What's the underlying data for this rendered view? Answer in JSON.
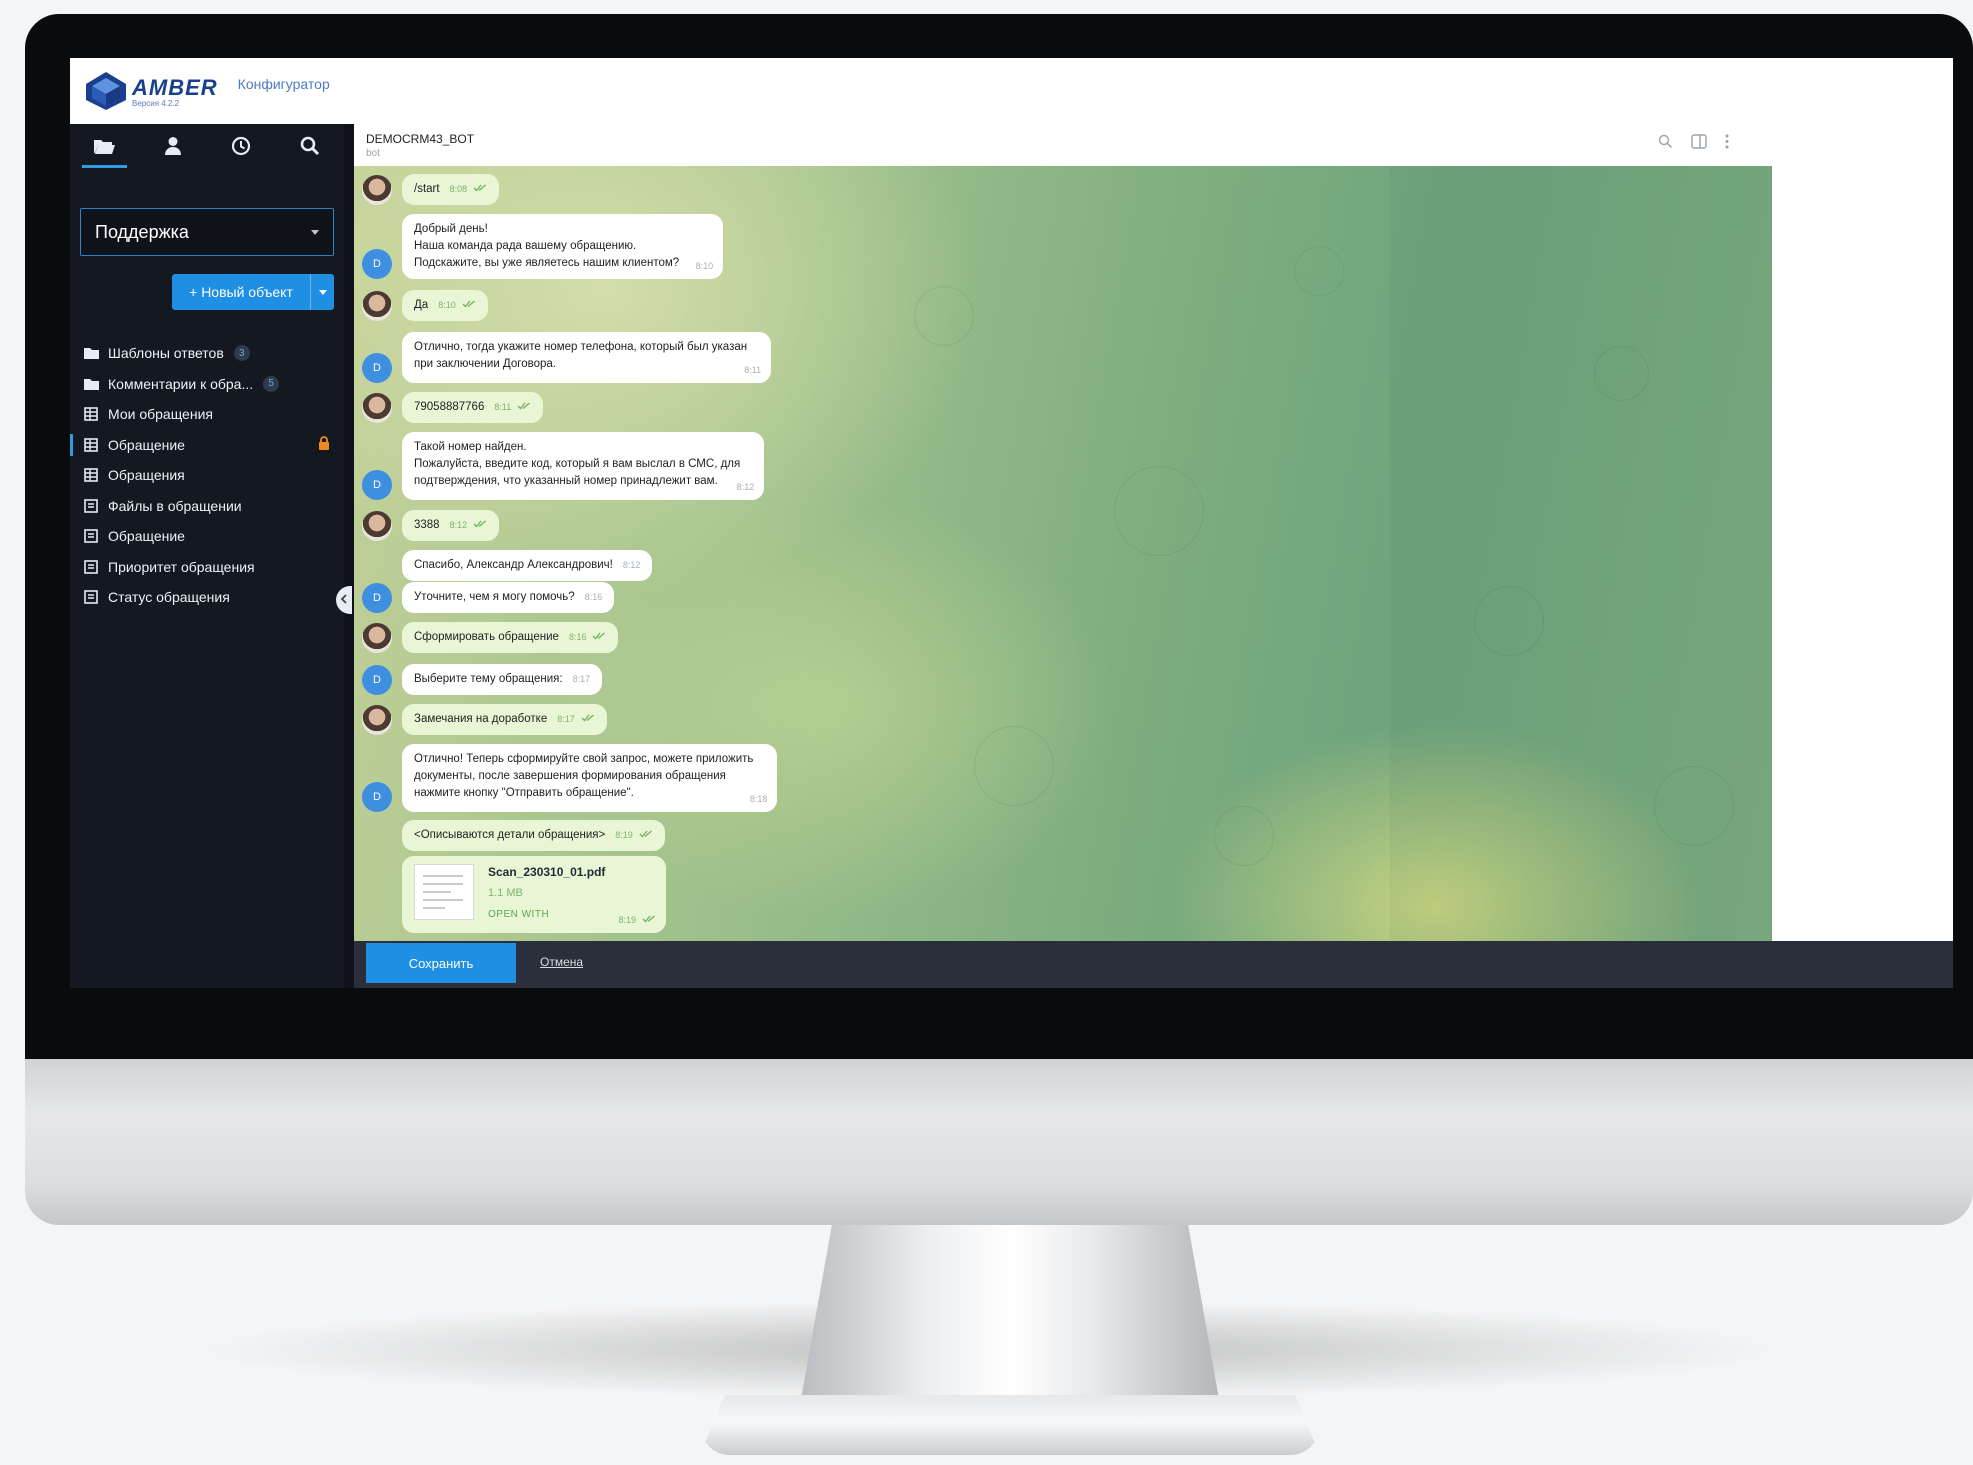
{
  "app": {
    "brand": "AMBER",
    "version": "Версия 4.2.2",
    "module": "Конфигуратор"
  },
  "colors": {
    "accent": "#1e8fe3",
    "sidebar_bg": "#141820",
    "brand": "#1a3f8f",
    "outgoing_bubble": "#e8f6d6",
    "lock": "#f0891c"
  },
  "sidebar": {
    "tabs": [
      {
        "icon": "folder-open-icon"
      },
      {
        "icon": "user-icon"
      },
      {
        "icon": "clock-icon"
      },
      {
        "icon": "search-icon"
      }
    ],
    "dropdown_value": "Поддержка",
    "new_object_label": "+ Новый объект",
    "items": [
      {
        "label": "Шаблоны ответов",
        "icon": "folder-icon",
        "badge": "3"
      },
      {
        "label": "Комментарии к обра...",
        "icon": "folder-icon",
        "badge": "5"
      },
      {
        "label": "Мои обращения",
        "icon": "table-icon"
      },
      {
        "label": "Обращение",
        "icon": "table-icon",
        "locked": true
      },
      {
        "label": "Обращения",
        "icon": "table-icon"
      },
      {
        "label": "Файлы в обращении",
        "icon": "form-icon"
      },
      {
        "label": "Обращение",
        "icon": "form-icon"
      },
      {
        "label": "Приоритет обращения",
        "icon": "form-icon"
      },
      {
        "label": "Статус обращения",
        "icon": "form-icon"
      }
    ]
  },
  "chat": {
    "title": "DEMOCRM43_BOT",
    "subtitle": "bot",
    "bot_avatar_letter": "D",
    "messages": [
      {
        "dir": "out",
        "text": "/start",
        "time": "8:08"
      },
      {
        "dir": "in",
        "text": "Добрый день!\nНаша команда рада вашему обращению.\nПодскажите, вы уже являетесь нашим клиентом?",
        "time": "8:10"
      },
      {
        "dir": "out",
        "text": "Да",
        "time": "8:10"
      },
      {
        "dir": "in",
        "text": "Отлично, тогда укажите номер телефона, который был указан\nпри заключении Договора.",
        "time": "8:11"
      },
      {
        "dir": "out",
        "text": "79058887766",
        "time": "8:11"
      },
      {
        "dir": "in",
        "text": "Такой номер найден.\nПожалуйста, введите код, который я вам выслал в СМС, для\nподтверждения, что указанный номер принадлежит вам.",
        "time": "8:12"
      },
      {
        "dir": "out",
        "text": "3388",
        "time": "8:12"
      },
      {
        "dir": "in",
        "text": "Спасибо, Александр Александрович!",
        "time": "8:12"
      },
      {
        "dir": "in",
        "text": "Уточните, чем я могу помочь?",
        "time": "8:16"
      },
      {
        "dir": "out",
        "text": "Сформировать обращение",
        "time": "8:16"
      },
      {
        "dir": "in",
        "text": "Выберите тему обращения:",
        "time": "8:17"
      },
      {
        "dir": "out",
        "text": "Замечания на доработке",
        "time": "8:17"
      },
      {
        "dir": "in",
        "text": "Отлично! Теперь сформируйте свой запрос, можете приложить\nдокументы, после завершения формирования обращения\nнажмите кнопку \"Отправить обращение\".",
        "time": "8:18"
      },
      {
        "dir": "out",
        "text": "<Описываются детали обращения>",
        "time": "8:19"
      }
    ],
    "file": {
      "name": "Scan_230310_01.pdf",
      "size": "1.1 MB",
      "action": "OPEN WITH",
      "time": "8:19"
    }
  },
  "footer": {
    "save_label": "Сохранить",
    "cancel_label": "Отмена"
  }
}
